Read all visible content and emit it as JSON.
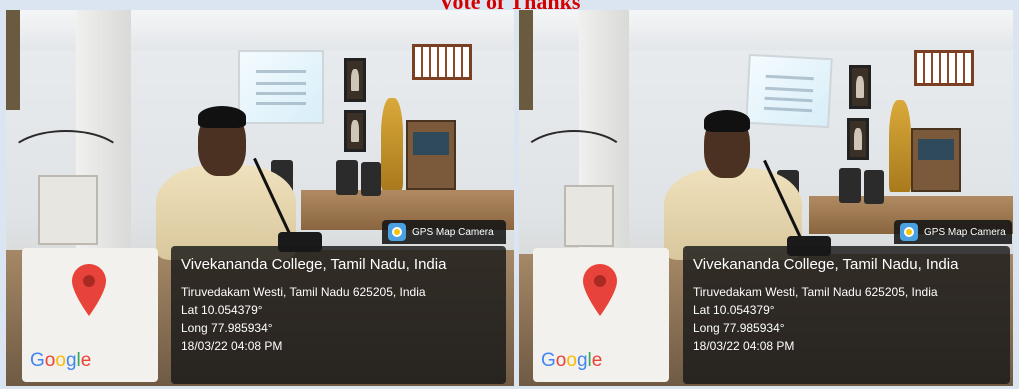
{
  "page": {
    "title": "Vote of Thanks"
  },
  "photos": [
    {
      "gps_badge": "GPS Map Camera",
      "location_title": "Vivekananda College, Tamil Nadu, India",
      "address": "Tiruvedakam Westi, Tamil Nadu 625205, India",
      "lat": "Lat 10.054379°",
      "long": "Long 77.985934°",
      "datetime": "18/03/22 04:08 PM",
      "map_logo": "Google"
    },
    {
      "gps_badge": "GPS Map Camera",
      "location_title": "Vivekananda College, Tamil Nadu, India",
      "address": "Tiruvedakam Westi, Tamil Nadu 625205, India",
      "lat": "Lat 10.054379°",
      "long": "Long 77.985934°",
      "datetime": "18/03/22 04:08 PM",
      "map_logo": "Google"
    }
  ],
  "colors": {
    "title": "#d40000",
    "map_pin": "#e8433a",
    "google_blue": "#4285f4",
    "google_red": "#ea4335",
    "google_yellow": "#fbbc05",
    "google_green": "#34a853"
  },
  "icons": [
    "gps-map-camera-icon",
    "map-pin-icon"
  ]
}
